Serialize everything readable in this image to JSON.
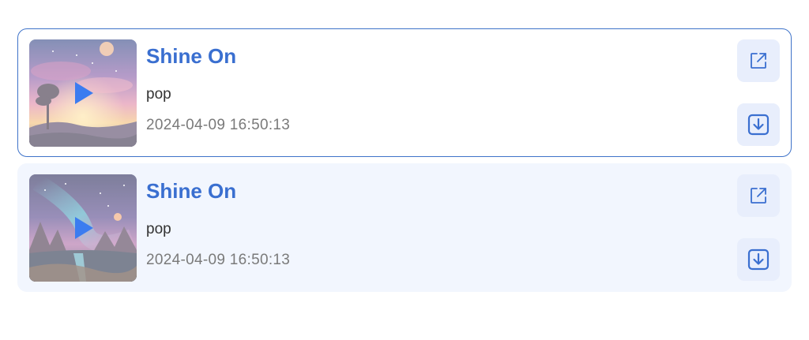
{
  "songs": [
    {
      "title": "Shine On",
      "genre": "pop",
      "date": "2024-04-09 16:50:13",
      "selected": true,
      "cover": "sunset-tree-art",
      "play_icon": "play-icon",
      "share_icon": "external-link-icon",
      "download_icon": "download-icon"
    },
    {
      "title": "Shine On",
      "genre": "pop",
      "date": "2024-04-09 16:50:13",
      "selected": false,
      "cover": "nebula-mountains-art",
      "play_icon": "play-icon",
      "share_icon": "external-link-icon",
      "download_icon": "download-icon"
    }
  ],
  "colors": {
    "accent": "#3a6fd0",
    "selected_border": "#3f73c9",
    "card_background": "#f2f6fe",
    "button_background": "#e8eefc",
    "play_icon": "#3b7cf0"
  }
}
